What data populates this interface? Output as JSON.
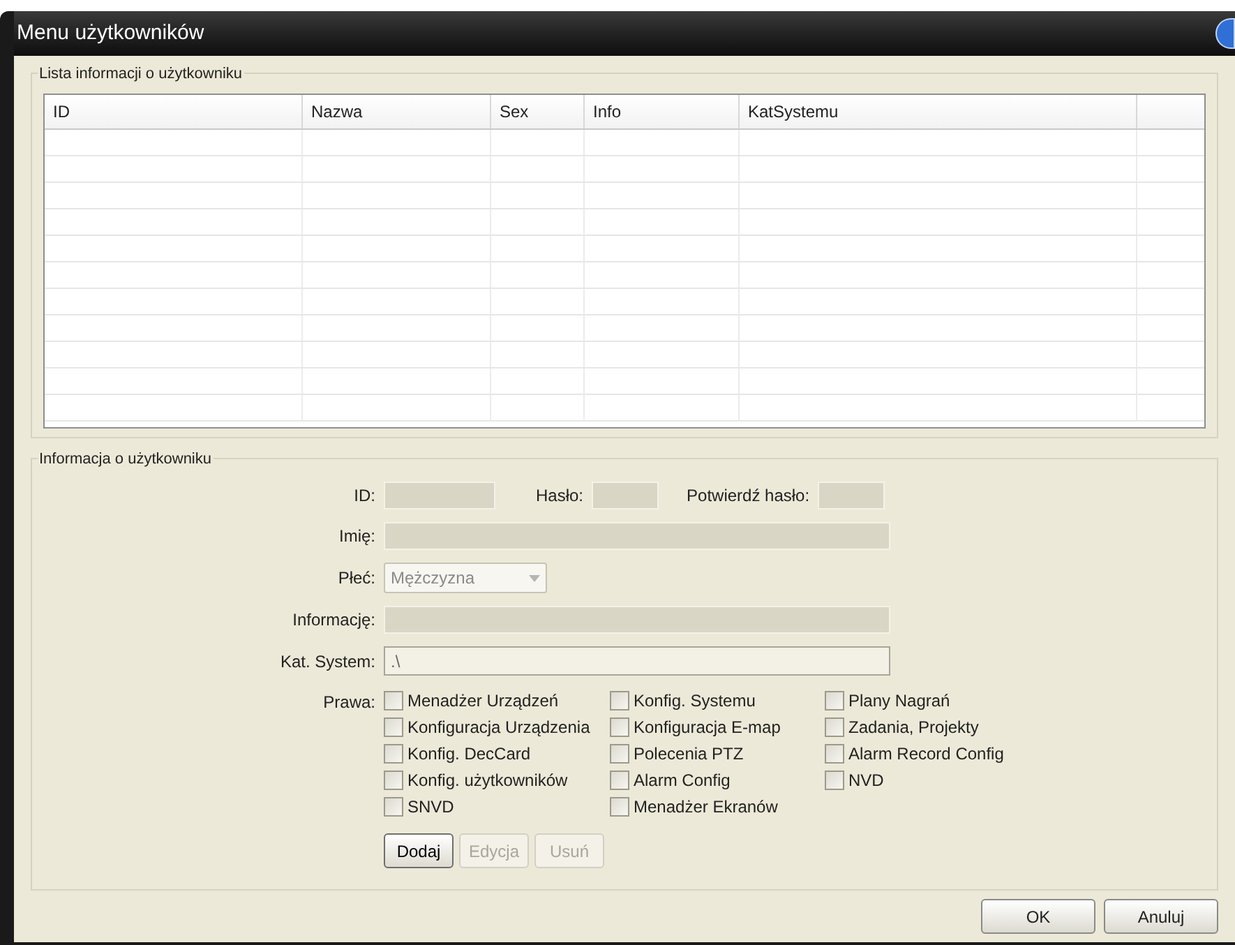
{
  "window": {
    "title": "Menu użytkowników"
  },
  "user_list": {
    "title": "Lista informacji o użytkowniku",
    "columns": [
      "ID",
      "Nazwa",
      "Sex",
      "Info",
      "KatSystemu"
    ]
  },
  "user_info": {
    "title": "Informacja o użytkowniku",
    "id": {
      "label": "ID:",
      "disabled": true
    },
    "password": {
      "label": "Hasło:",
      "disabled": true
    },
    "confirm_password": {
      "label": "Potwierdź hasło:",
      "disabled": true
    },
    "name": {
      "label": "Imię:",
      "disabled": true
    },
    "sex": {
      "label": "Płeć:",
      "value": "Mężczyzna",
      "disabled": true
    },
    "information": {
      "label": "Informację:",
      "disabled": true
    },
    "system_dir": {
      "label": "Kat. System:",
      "value": ".\\",
      "disabled": false
    },
    "rights_label": "Prawa:",
    "rights": [
      [
        {
          "label": "Menadżer Urządzeń",
          "checked": false
        },
        {
          "label": "Konfiguracja Urządzenia",
          "checked": false
        },
        {
          "label": "Konfig. DecCard",
          "checked": false
        },
        {
          "label": "Konfig. użytkowników",
          "checked": false
        },
        {
          "label": "SNVD",
          "checked": false
        }
      ],
      [
        {
          "label": "Konfig. Systemu",
          "checked": false
        },
        {
          "label": "Konfiguracja E-map",
          "checked": false
        },
        {
          "label": "Polecenia PTZ",
          "checked": false
        },
        {
          "label": "Alarm Config",
          "checked": false
        },
        {
          "label": "Menadżer Ekranów",
          "checked": false
        }
      ],
      [
        {
          "label": "Plany Nagrań",
          "checked": false
        },
        {
          "label": "Zadania, Projekty",
          "checked": false
        },
        {
          "label": "Alarm Record Config",
          "checked": false
        },
        {
          "label": "NVD",
          "checked": false
        }
      ]
    ],
    "buttons": [
      {
        "label": "Dodaj",
        "disabled": false
      },
      {
        "label": "Edycja",
        "disabled": true
      },
      {
        "label": "Usuń",
        "disabled": true
      }
    ]
  },
  "footer_buttons": [
    {
      "label": "OK"
    },
    {
      "label": "Anuluj"
    }
  ]
}
